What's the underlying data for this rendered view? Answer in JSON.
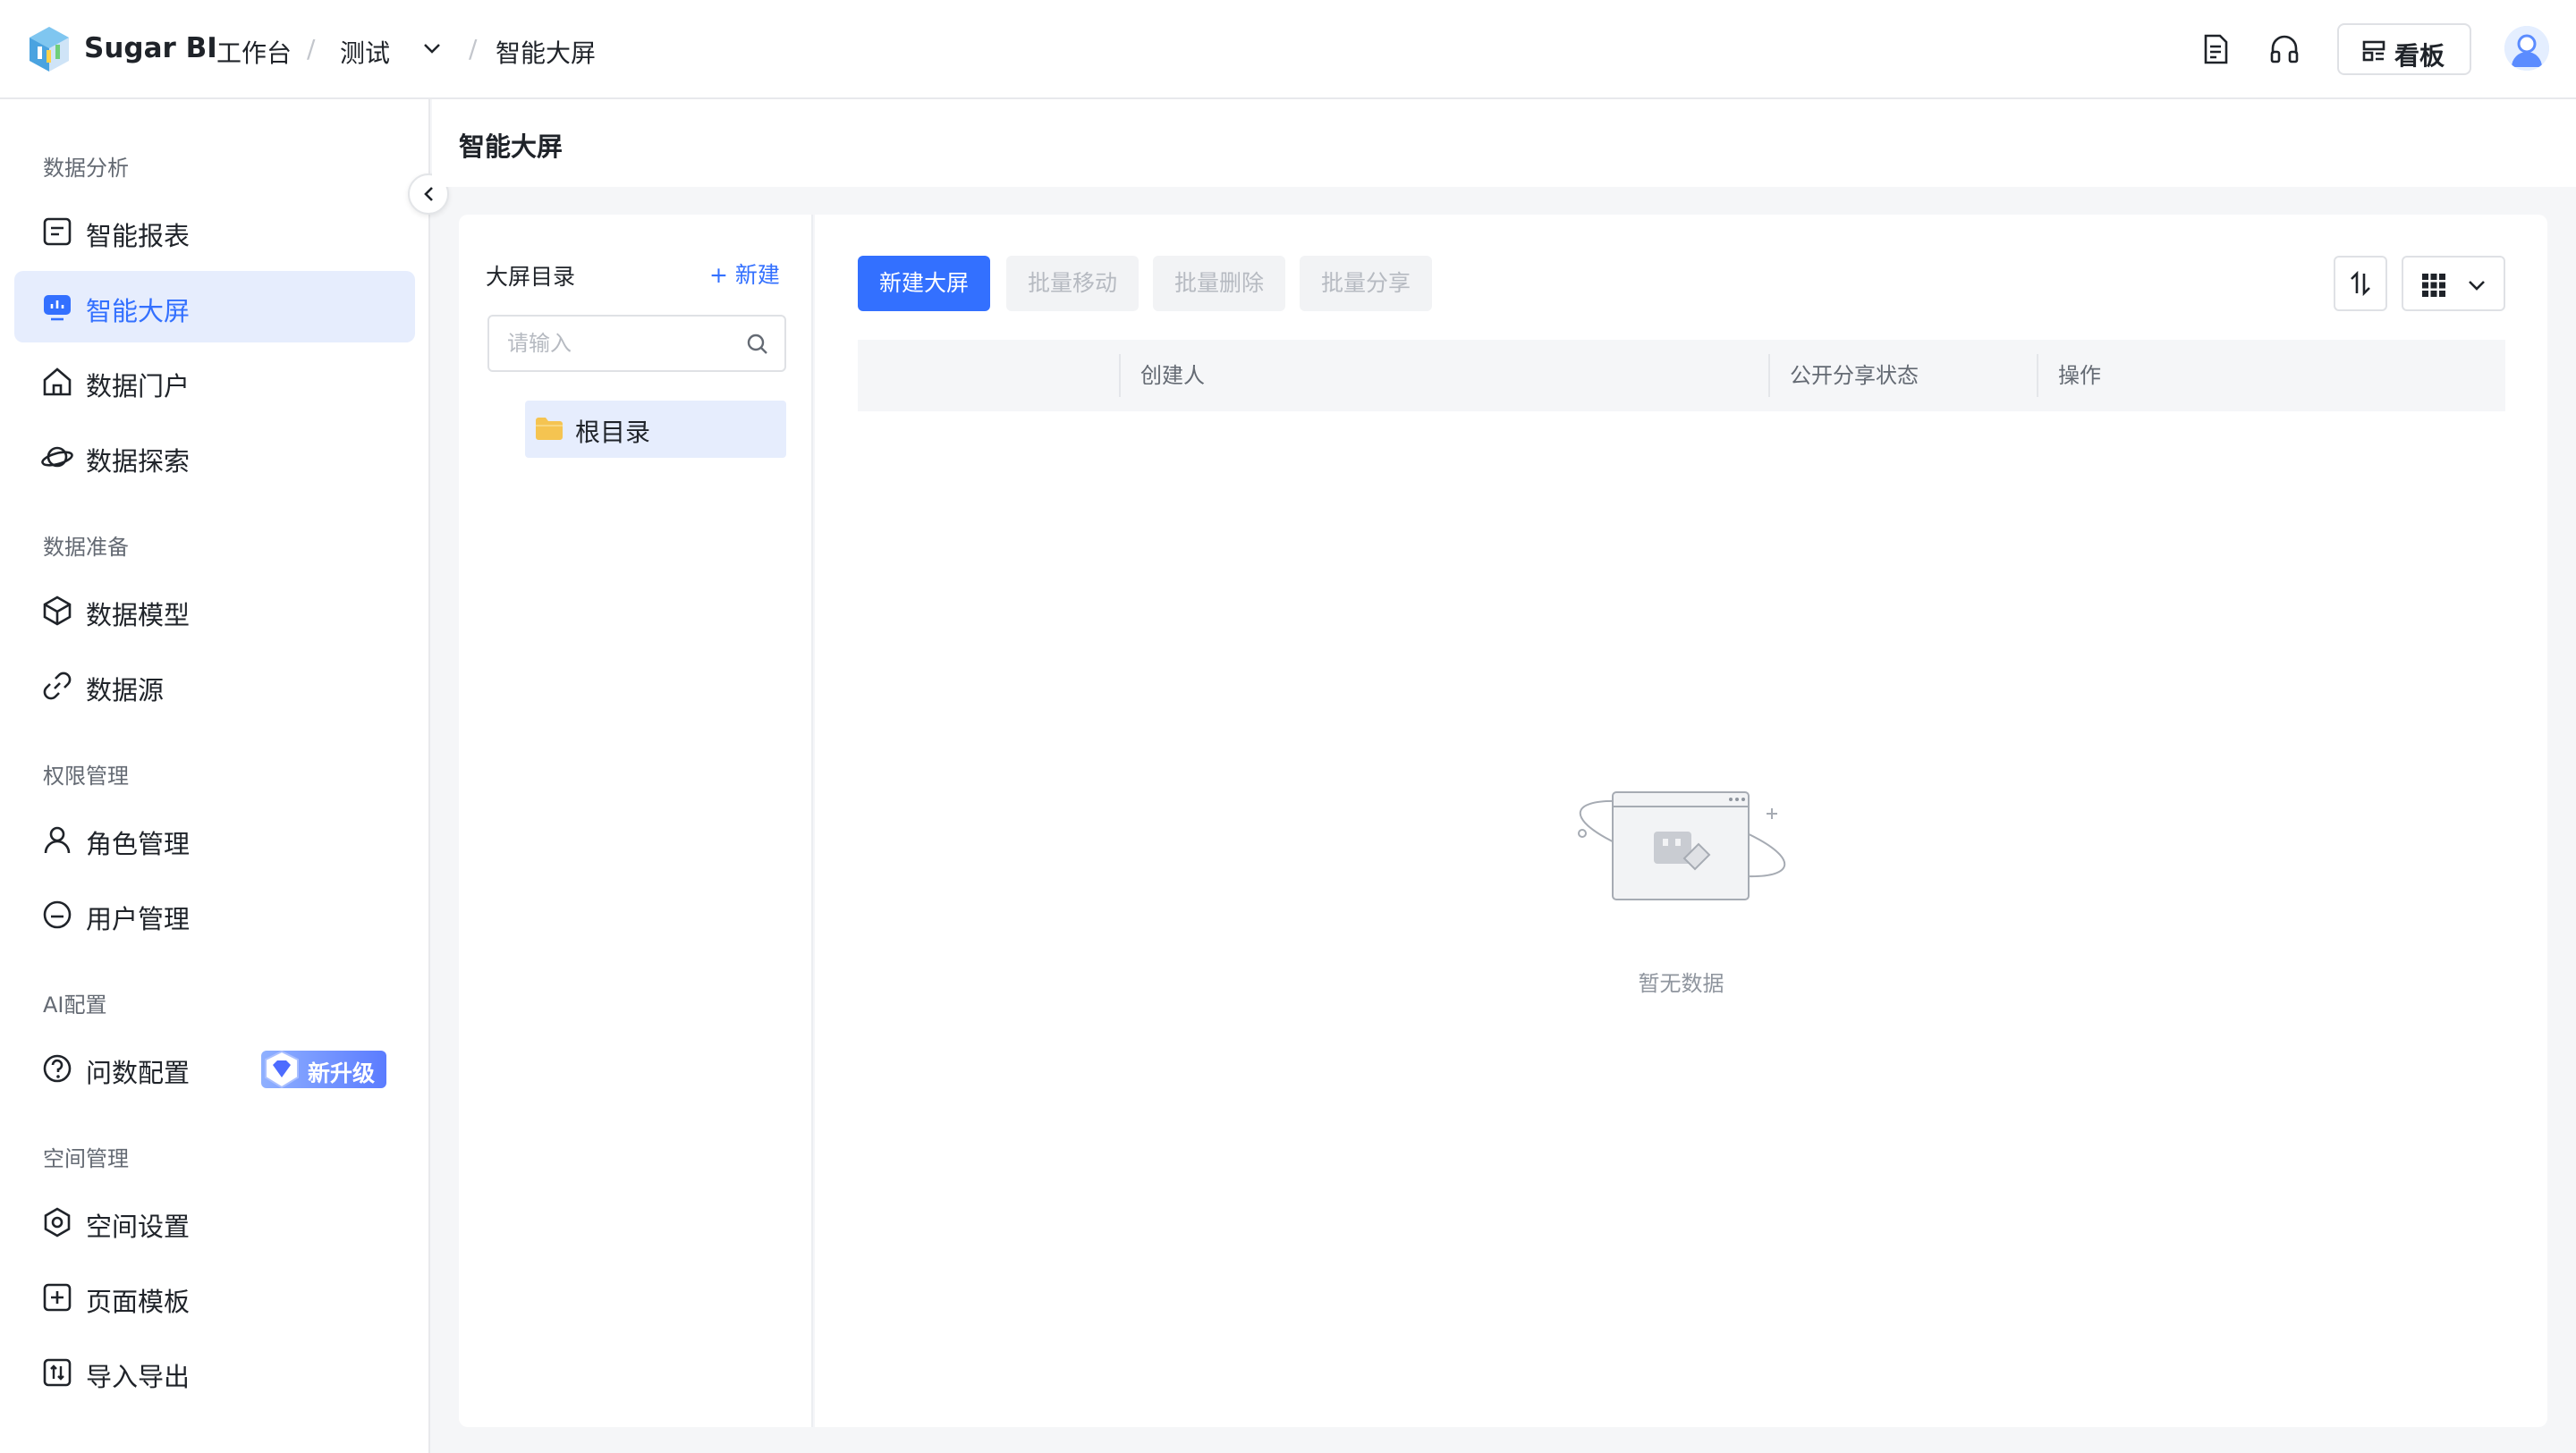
{
  "topbar": {
    "brand": "Sugar BI",
    "workspace": "工作台",
    "project": "测试",
    "current": "智能大屏",
    "kanban_label": "看板",
    "icons": [
      "doc-icon",
      "headset-icon",
      "dashboard-icon",
      "avatar"
    ]
  },
  "sidebar": {
    "sections": [
      {
        "title": "数据分析",
        "items": [
          {
            "label": "智能报表",
            "icon": "report-icon",
            "active": false
          },
          {
            "label": "智能大屏",
            "icon": "screen-icon",
            "active": true
          },
          {
            "label": "数据门户",
            "icon": "home-icon",
            "active": false
          },
          {
            "label": "数据探索",
            "icon": "planet-icon",
            "active": false
          }
        ]
      },
      {
        "title": "数据准备",
        "items": [
          {
            "label": "数据模型",
            "icon": "cube-icon",
            "active": false
          },
          {
            "label": "数据源",
            "icon": "link-icon",
            "active": false
          }
        ]
      },
      {
        "title": "权限管理",
        "items": [
          {
            "label": "角色管理",
            "icon": "user-icon",
            "active": false
          },
          {
            "label": "用户管理",
            "icon": "user-circle-icon",
            "active": false
          }
        ]
      },
      {
        "title": "AI配置",
        "items": [
          {
            "label": "问数配置",
            "icon": "question-icon",
            "active": false,
            "badge": "新升级"
          }
        ]
      },
      {
        "title": "空间管理",
        "items": [
          {
            "label": "空间设置",
            "icon": "settings-icon",
            "active": false
          },
          {
            "label": "页面模板",
            "icon": "template-icon",
            "active": false
          },
          {
            "label": "导入导出",
            "icon": "import-export-icon",
            "active": false
          }
        ]
      }
    ]
  },
  "page": {
    "title": "智能大屏"
  },
  "directory": {
    "title": "大屏目录",
    "new_label": "新建",
    "search_placeholder": "请输入",
    "root": "根目录"
  },
  "toolbar": {
    "new_screen": "新建大屏",
    "batch_move": "批量移动",
    "batch_delete": "批量删除",
    "batch_share": "批量分享"
  },
  "table": {
    "columns": [
      "",
      "创建人",
      "公开分享状态",
      "操作"
    ],
    "rows": []
  },
  "empty": {
    "text": "暂无数据"
  },
  "colors": {
    "accent": "#3370ff",
    "active_bg": "#e6edfd",
    "folder": "#f5c451"
  }
}
